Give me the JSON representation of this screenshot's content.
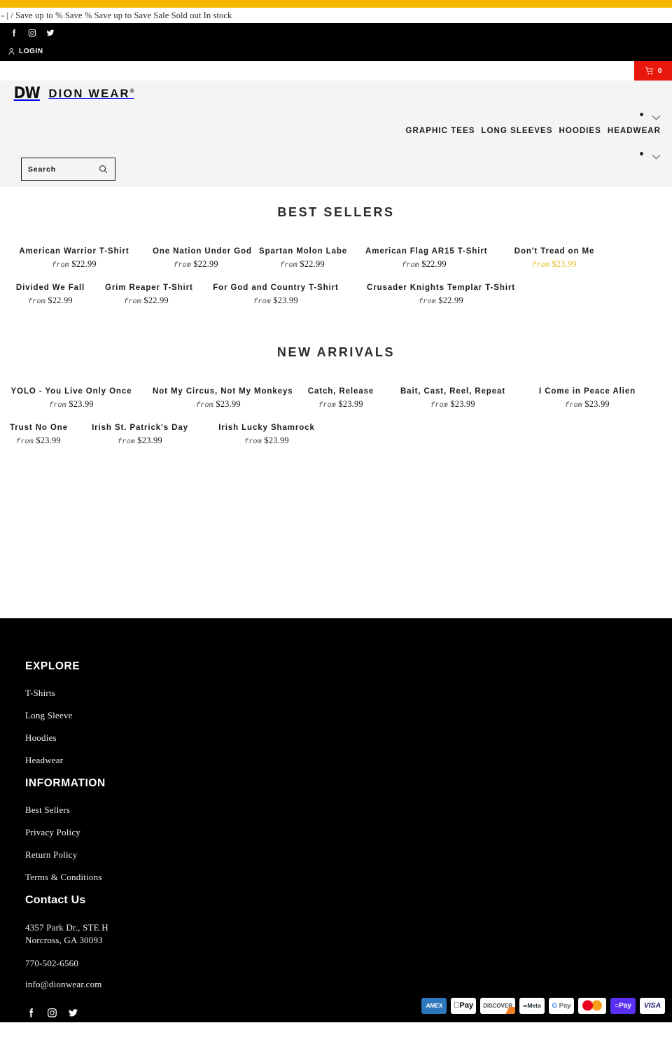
{
  "announcement": {
    "text": "- | / Save up to % Save % Save up to Save Sale Sold out In stock"
  },
  "utility": {
    "social": [
      {
        "name": "facebook-icon",
        "label": "Facebook"
      },
      {
        "name": "instagram-icon",
        "label": "Instagram"
      },
      {
        "name": "twitter-icon",
        "label": "Twitter"
      }
    ],
    "login_label": "LOGIN",
    "account_icon": "user-icon"
  },
  "cart": {
    "icon": "cart-icon",
    "count": "0",
    "color": "#e8180c"
  },
  "header": {
    "logo_mark": "DW",
    "logo_word": "DION WEAR",
    "logo_registered": "®",
    "nav": [
      {
        "label": "GRAPHIC TEES"
      },
      {
        "label": "LONG SLEEVES"
      },
      {
        "label": "HOODIES"
      },
      {
        "label": "HEADWEAR"
      }
    ],
    "search": {
      "placeholder": "Search",
      "icon": "search-icon"
    },
    "carousel_controls": [
      {
        "dot": "dot-indicator",
        "chevron": "chevron-down-icon"
      },
      {
        "dot": "dot-indicator",
        "chevron": "chevron-down-icon"
      }
    ],
    "bg_color": "#f4f4f4"
  },
  "sections": [
    {
      "title": "BEST SELLERS",
      "rows": [
        [
          {
            "name": "American Warrior T-Shirt",
            "from": "from",
            "price": "$22.99",
            "sale": false
          },
          {
            "name": "One Nation Under God",
            "from": "from",
            "price": "$22.99",
            "sale": false
          },
          {
            "name": "Spartan Molon Labe",
            "from": "from",
            "price": "$22.99",
            "sale": false
          },
          {
            "name": "American Flag AR15 T-Shirt",
            "from": "from",
            "price": "$22.99",
            "sale": false
          },
          {
            "name": "Don't Tread on Me",
            "from": "from",
            "price": "$23.99",
            "sale": true
          }
        ],
        [
          {
            "name": "Divided We Fall",
            "from": "from",
            "price": "$22.99",
            "sale": false
          },
          {
            "name": "Grim Reaper T-Shirt",
            "from": "from",
            "price": "$22.99",
            "sale": false
          },
          {
            "name": "For God and Country T-Shirt",
            "from": "from",
            "price": "$23.99",
            "sale": false
          },
          {
            "name": "Crusader Knights Templar T-Shirt",
            "from": "from",
            "price": "$22.99",
            "sale": false
          }
        ]
      ]
    },
    {
      "title": "NEW ARRIVALS",
      "rows": [
        [
          {
            "name": "YOLO - You Live Only Once",
            "from": "from",
            "price": "$23.99",
            "sale": false
          },
          {
            "name": "Not My Circus, Not My Monkeys",
            "from": "from",
            "price": "$23.99",
            "sale": false
          },
          {
            "name": "Catch, Release",
            "from": "from",
            "price": "$23.99",
            "sale": false
          },
          {
            "name": "Bait, Cast, Reel, Repeat",
            "from": "from",
            "price": "$23.99",
            "sale": false
          },
          {
            "name": "I Come in Peace Alien",
            "from": "from",
            "price": "$23.99",
            "sale": false
          }
        ],
        [
          {
            "name": "Trust No One",
            "from": "from",
            "price": "$23.99",
            "sale": false
          },
          {
            "name": "Irish St. Patrick's Day",
            "from": "from",
            "price": "$23.99",
            "sale": false
          },
          {
            "name": "Irish Lucky Shamrock",
            "from": "from",
            "price": "$23.99",
            "sale": false
          }
        ]
      ]
    }
  ],
  "footer": {
    "explore_heading": "EXPLORE",
    "explore_links": [
      {
        "label": "T-Shirts"
      },
      {
        "label": "Long Sleeve"
      },
      {
        "label": "Hoodies"
      },
      {
        "label": "Headwear"
      }
    ],
    "information_heading": "INFORMATION",
    "information_links": [
      {
        "label": "Best Sellers"
      },
      {
        "label": "Privacy Policy"
      },
      {
        "label": "Return Policy"
      },
      {
        "label": "Terms & Conditions"
      }
    ],
    "contact_heading": "Contact Us",
    "address_line1": "4357 Park Dr., STE H",
    "address_line2": "Norcross, GA 30093",
    "phone": "770-502-6560",
    "email": "info@dionwear.com",
    "social": [
      {
        "name": "facebook-icon",
        "label": "Facebook"
      },
      {
        "name": "instagram-icon",
        "label": "Instagram"
      },
      {
        "name": "twitter-icon",
        "label": "Twitter"
      }
    ],
    "payments": [
      {
        "id": "amex",
        "label": "AMEX"
      },
      {
        "id": "apple-pay",
        "label": "Pay"
      },
      {
        "id": "discover",
        "label": "DISCOVER"
      },
      {
        "id": "meta-pay",
        "label": "Meta"
      },
      {
        "id": "google-pay",
        "label": "Pay"
      },
      {
        "id": "mastercard",
        "label": ""
      },
      {
        "id": "shop-pay",
        "label": "Pay"
      },
      {
        "id": "visa",
        "label": "VISA"
      }
    ]
  },
  "colors": {
    "top_bar": "#f5b800",
    "cart": "#e8180c",
    "sale_price": "#e3c02c",
    "header_bg": "#f4f4f4",
    "footer_bg": "#000000"
  }
}
